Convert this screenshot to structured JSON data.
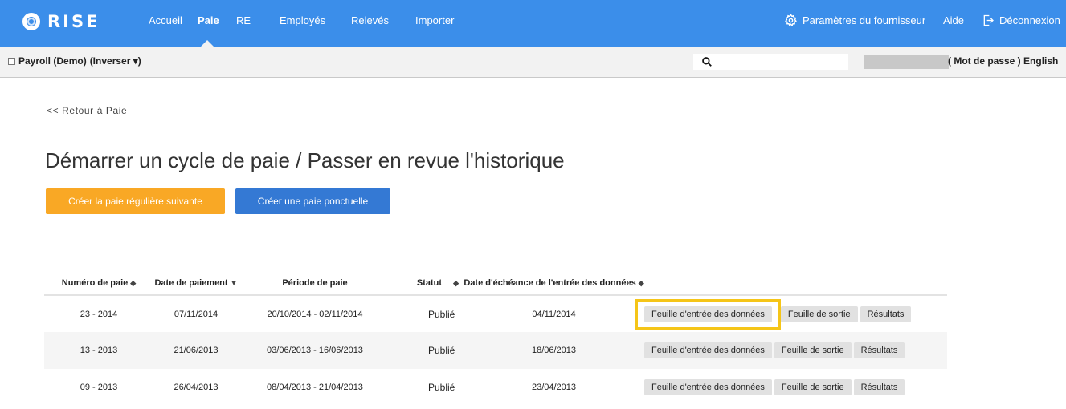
{
  "brand": {
    "name": "RISE"
  },
  "nav": {
    "items": [
      {
        "label": "Accueil",
        "active": false
      },
      {
        "label": "Paie",
        "active": true
      },
      {
        "label": "RE",
        "active": false
      },
      {
        "label": "Employés",
        "active": false
      },
      {
        "label": "Relevés",
        "active": false
      },
      {
        "label": "Importer",
        "active": false
      }
    ],
    "settings_label": "Paramètres du fournisseur",
    "help_label": "Aide",
    "logout_label": "Déconnexion"
  },
  "subbar": {
    "company_name": "Payroll (Demo)",
    "invert_label": "(Inverser ▾)",
    "search_placeholder": "",
    "password_link": "( Mot de passe )",
    "language_link": "English"
  },
  "main": {
    "back_link": "<< Retour à Paie",
    "title": "Démarrer un cycle de paie / Passer en revue l'historique",
    "create_regular_label": "Créer la paie régulière suivante",
    "create_oneoff_label": "Créer une paie ponctuelle"
  },
  "table": {
    "headers": {
      "pay_number": "Numéro de paie",
      "pay_date": "Date de paiement",
      "pay_period": "Période de paie",
      "status": "Statut",
      "due_date": "Date d'échéance de l'entrée des données"
    },
    "rows": [
      {
        "pay_number": "23 - 2014",
        "pay_date": "07/11/2014",
        "pay_period": "20/10/2014 - 02/11/2014",
        "status": "Publié",
        "due_date": "04/11/2014"
      },
      {
        "pay_number": "13 - 2013",
        "pay_date": "21/06/2013",
        "pay_period": "03/06/2013 - 16/06/2013",
        "status": "Publié",
        "due_date": "18/06/2013"
      },
      {
        "pay_number": "09 - 2013",
        "pay_date": "26/04/2013",
        "pay_period": "08/04/2013 - 21/04/2013",
        "status": "Publié",
        "due_date": "23/04/2013"
      }
    ],
    "actions": {
      "data_entry": "Feuille d'entrée des données",
      "output": "Feuille de sortie",
      "results": "Résultats"
    }
  },
  "colors": {
    "header_blue": "#3b8eea",
    "orange_button": "#f9a825",
    "blue_button": "#3479d4",
    "highlight": "#f5c518"
  }
}
